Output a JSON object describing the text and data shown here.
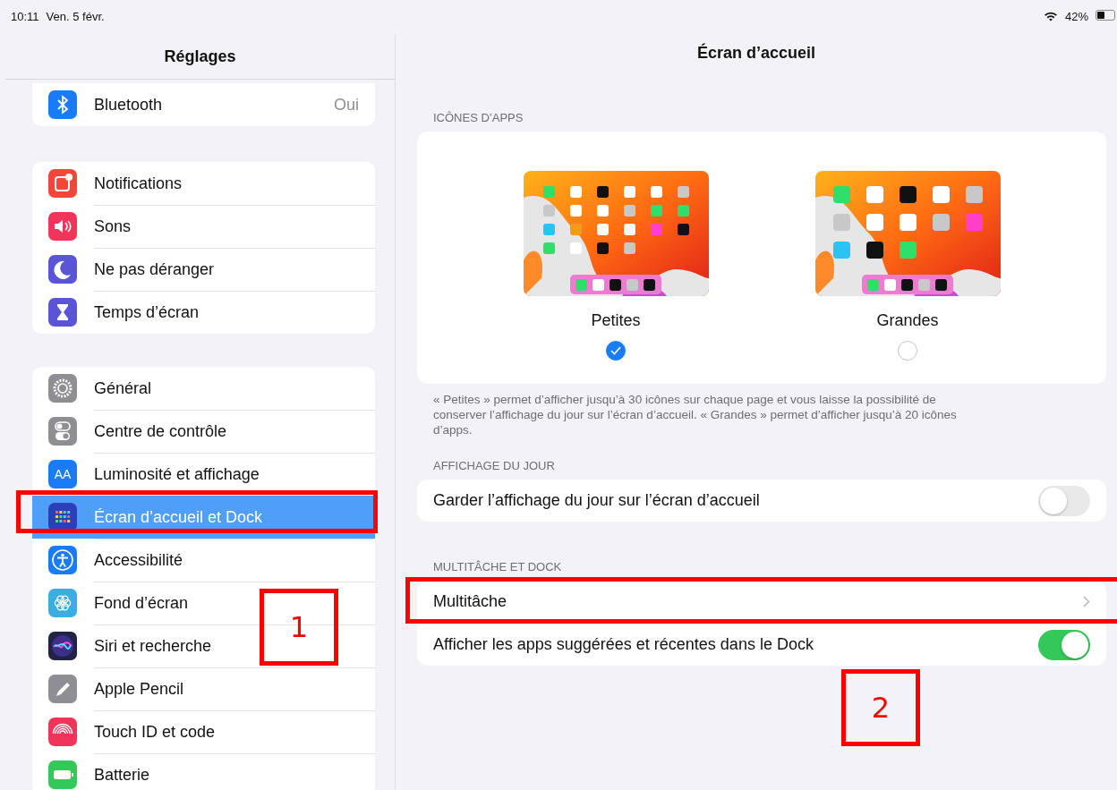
{
  "status_bar": {
    "time": "10:11",
    "date": "Ven. 5 févr.",
    "battery": "42%"
  },
  "sidebar": {
    "title": "Réglages",
    "groups": [
      {
        "items": [
          {
            "label": "Bluetooth",
            "value": "Oui",
            "color": "#1a7cf5",
            "selected": false
          }
        ]
      },
      {
        "items": [
          {
            "label": "Notifications",
            "color": "#f2463a",
            "selected": false
          },
          {
            "label": "Sons",
            "color": "#f0345a",
            "selected": false
          },
          {
            "label": "Ne pas déranger",
            "color": "#5a55d6",
            "selected": false
          },
          {
            "label": "Temps d’écran",
            "color": "#5a55d6",
            "selected": false
          }
        ]
      },
      {
        "items": [
          {
            "label": "Général",
            "color": "#8e8e93",
            "selected": false
          },
          {
            "label": "Centre de contrôle",
            "color": "#8e8e93",
            "selected": false
          },
          {
            "label": "Luminosité et affichage",
            "color": "#1a7cf5",
            "glyph": "AA",
            "selected": false
          },
          {
            "label": "Écran d’accueil et Dock",
            "color": "#2c3fb8",
            "selected": true
          },
          {
            "label": "Accessibilité",
            "color": "#1a7cf5",
            "selected": false
          },
          {
            "label": "Fond d’écran",
            "color": "#3aaee0",
            "selected": false
          },
          {
            "label": "Siri et recherche",
            "color": "#222244",
            "selected": false
          },
          {
            "label": "Apple Pencil",
            "color": "#8e8e93",
            "selected": false
          },
          {
            "label": "Touch ID et code",
            "color": "#f0345a",
            "selected": false
          },
          {
            "label": "Batterie",
            "color": "#34c759",
            "selected": false
          }
        ]
      }
    ]
  },
  "detail": {
    "title": "Écran d’accueil",
    "sections": [
      {
        "header": "ICÔNES D’APPS",
        "kind": "icon-size",
        "options": [
          {
            "label": "Petites",
            "kind": "small",
            "selected": true
          },
          {
            "label": "Grandes",
            "kind": "large",
            "selected": false
          }
        ],
        "footer": "« Petites » permet d’afficher jusqu’à 30 icônes sur chaque page et vous laisse la possibilité de conserver l’affichage du jour sur l’écran d’accueil. « Grandes » permet d’afficher jusqu’à 20 icônes d’apps."
      },
      {
        "header": "AFFICHAGE DU JOUR",
        "kind": "rows",
        "rows": [
          {
            "label": "Garder l’affichage du jour sur l’écran d’accueil",
            "kind": "toggle",
            "on": false
          }
        ]
      },
      {
        "header": "MULTITÂCHE ET DOCK",
        "kind": "rows",
        "rows": [
          {
            "label": "Multitâche",
            "kind": "link"
          },
          {
            "label": "Afficher les apps suggérées et récentes dans le Dock",
            "kind": "toggle",
            "on": true
          }
        ]
      }
    ]
  },
  "annotations": [
    {
      "kind": "frame"
    },
    {
      "kind": "numbered",
      "label": "1"
    },
    {
      "kind": "frame"
    },
    {
      "kind": "numbered",
      "label": "2"
    }
  ]
}
